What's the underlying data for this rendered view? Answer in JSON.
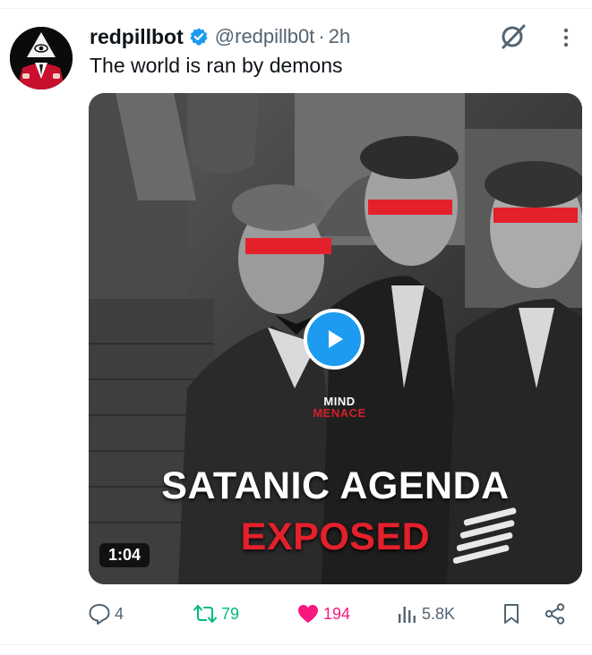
{
  "tweet": {
    "author": {
      "display_name": "redpillbot",
      "handle": "@redpillb0t",
      "verified": true
    },
    "separator": "·",
    "time": "2h",
    "text": "The world is ran by demons",
    "media": {
      "type": "video",
      "duration": "1:04",
      "watermark": {
        "top": "MIND",
        "bottom": "MENACE"
      },
      "caption": {
        "line1": "SATANIC AGENDA",
        "line2": "EXPOSED"
      },
      "accent_colors": {
        "censor_bar": "#e4202b",
        "play": "#1d9bf0"
      }
    },
    "metrics": {
      "replies": "4",
      "reposts": "79",
      "likes": "194",
      "views": "5.8K",
      "liked": true
    }
  },
  "icons": {
    "verified": "verified-badge-icon",
    "slash": "grok-slash-icon",
    "more": "more-vertical-icon",
    "reply": "reply-icon",
    "repost": "repost-icon",
    "like": "heart-icon",
    "views": "views-bar-chart-icon",
    "bookmark": "bookmark-icon",
    "share": "share-icon"
  },
  "colors": {
    "text_primary": "#0f1419",
    "text_secondary": "#536471",
    "verified_blue": "#1d9bf0",
    "repost_green": "#00ba7c",
    "like_pink": "#f91880"
  }
}
